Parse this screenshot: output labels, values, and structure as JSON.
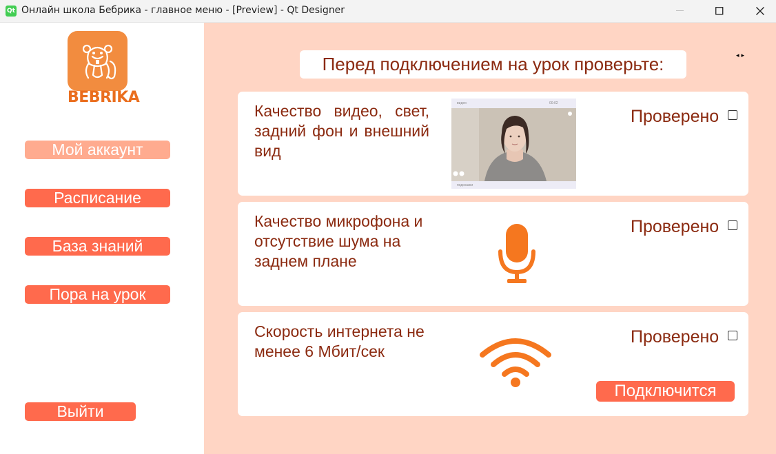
{
  "window": {
    "title": "Онлайн школа Бебрика - главное меню - [Preview] - Qt Designer",
    "app_icon_text": "Qt"
  },
  "sidebar": {
    "logo_text": "BEBRIKA",
    "nav": [
      {
        "label": "Мой аккаунт",
        "active": true
      },
      {
        "label": "Расписание",
        "active": false
      },
      {
        "label": "База знаний",
        "active": false
      },
      {
        "label": "Пора на урок",
        "active": false
      }
    ],
    "logout_label": "Выйти"
  },
  "main": {
    "heading": "Перед подключением на урок проверьте:",
    "arrows": "◂▸",
    "cards": [
      {
        "text": "Качество видео, свет, задний фон и внешний вид",
        "checked_label": "Проверено",
        "checked": false,
        "media": "video-preview"
      },
      {
        "text": "Качество микрофона и отсутствие шума на заднем плане",
        "checked_label": "Проверено",
        "checked": false,
        "media": "microphone-icon"
      },
      {
        "text": "Скорость интернета не менее 6 Мбит/сек",
        "checked_label": "Проверено",
        "checked": false,
        "media": "wifi-icon"
      }
    ],
    "video_preview": {
      "top_label": "видео",
      "timer": "00:02",
      "bottom_label": "подсказки"
    },
    "connect_label": "Подключится"
  },
  "colors": {
    "accent": "#ff6a4d",
    "accent_active": "#ffab8f",
    "panel_bg": "#ffd5c4",
    "text_dark": "#8b2a10",
    "icon_orange": "#f5771f"
  }
}
